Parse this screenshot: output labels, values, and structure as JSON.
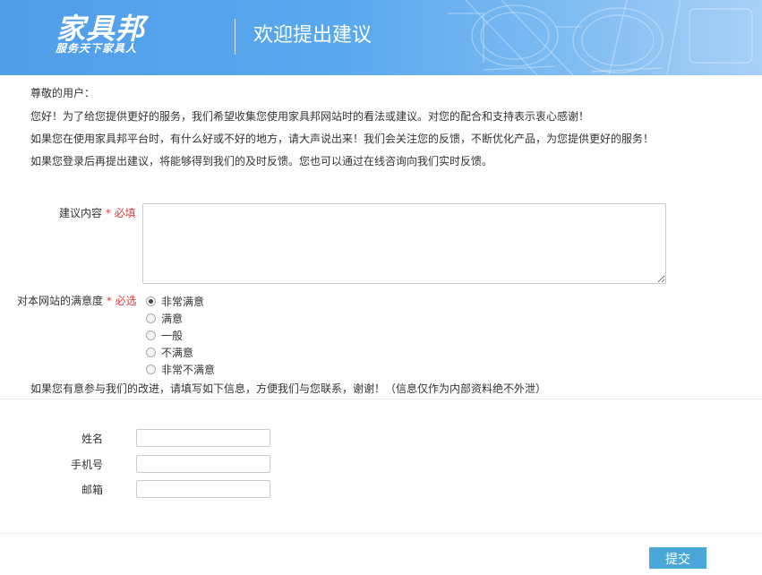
{
  "header": {
    "logo_main": "家具邦",
    "logo_sub": "服务天下家具人",
    "title": "欢迎提出建议"
  },
  "intro": {
    "greeting": "尊敬的用户：",
    "line1": "您好！为了给您提供更好的服务，我们希望收集您使用家具邦网站时的看法或建议。对您的配合和支持表示衷心感谢！",
    "line2": "如果您在使用家具邦平台时，有什么好或不好的地方，请大声说出来！我们会关注您的反馈，不断优化产品，为您提供更好的服务！",
    "line3": "如果您登录后再提出建议，将能够得到我们的及时反馈。您也可以通过在线咨询向我们实时反馈。"
  },
  "form": {
    "suggestion_label": "建议内容",
    "suggestion_required": "* 必填",
    "satisfaction_label": "对本网站的满意度",
    "satisfaction_required": "* 必选",
    "satisfaction_options": [
      "非常满意",
      "满意",
      "一般",
      "不满意",
      "非常不满意"
    ],
    "satisfaction_selected": "非常满意",
    "contact_note": "如果您有意参与我们的改进，请填写如下信息，方便我们与您联系，谢谢！（信息仅作为内部资料绝不外泄）",
    "name_label": "姓名",
    "phone_label": "手机号",
    "email_label": "邮箱",
    "submit_label": "提交"
  }
}
